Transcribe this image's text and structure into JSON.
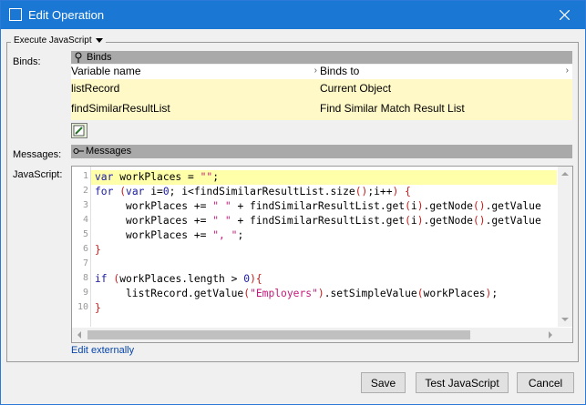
{
  "window": {
    "title": "Edit Operation"
  },
  "group": {
    "legend": "Execute JavaScript"
  },
  "binds": {
    "label": "Binds:",
    "header": "Binds",
    "columns": [
      "Variable name",
      "Binds to"
    ],
    "rows": [
      {
        "variable": "listRecord",
        "binds_to": "Current Object"
      },
      {
        "variable": "findSimilarResultList",
        "binds_to": "Find Similar Match Result List"
      }
    ]
  },
  "messages": {
    "label": "Messages:",
    "header": "Messages"
  },
  "javascript": {
    "label": "JavaScript:",
    "line_numbers": [
      "1",
      "2",
      "3",
      "4",
      "5",
      "6",
      "7",
      "8",
      "9",
      "10"
    ],
    "lines": [
      "var workPlaces = \"\";",
      "for (var i=0; i<findSimilarResultList.size();i++) {",
      "     workPlaces += \" \" + findSimilarResultList.get(i).getNode().getValue",
      "     workPlaces += \" \" + findSimilarResultList.get(i).getNode().getValue",
      "     workPlaces += \", \";",
      "}",
      "",
      "if (workPlaces.length > 0){",
      "     listRecord.getValue(\"Employers\").setSimpleValue(workPlaces);",
      "}"
    ]
  },
  "edit_externally": "Edit externally",
  "buttons": {
    "save": "Save",
    "test": "Test JavaScript",
    "cancel": "Cancel"
  }
}
